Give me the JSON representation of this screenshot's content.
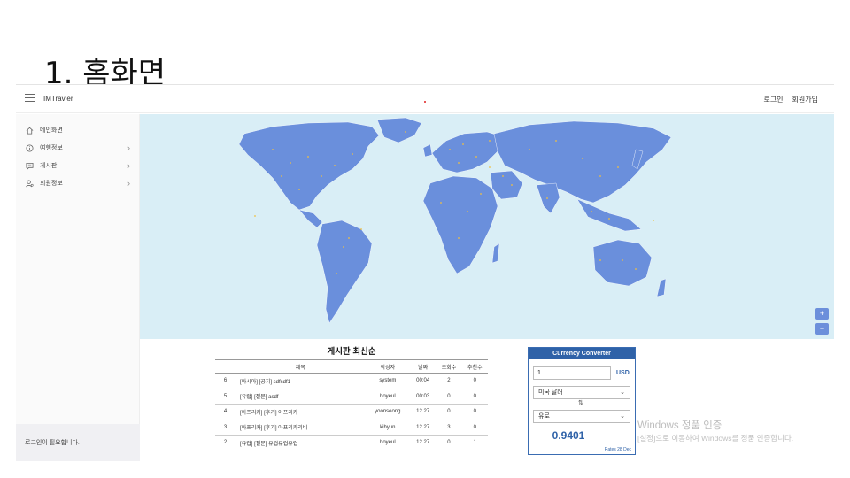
{
  "slide": {
    "title": "1. 홈화면"
  },
  "header": {
    "brand": "IMTravler",
    "links": [
      "로그인",
      "회원가입"
    ]
  },
  "sidebar": {
    "items": [
      {
        "label": "메인화면",
        "icon": "home-icon",
        "has_arrow": false
      },
      {
        "label": "여행정보",
        "icon": "info-icon",
        "has_arrow": true
      },
      {
        "label": "게시판",
        "icon": "chat-icon",
        "has_arrow": true
      },
      {
        "label": "회원정보",
        "icon": "user-settings-icon",
        "has_arrow": true
      }
    ],
    "footer": "로그인이 필요합니다."
  },
  "map": {
    "zoom_in": "+",
    "zoom_out": "−",
    "land_color": "#6a8fdc",
    "sea_color": "#d9eef6"
  },
  "board": {
    "title": "게시판 최신순",
    "columns": [
      "",
      "제목",
      "작성자",
      "날짜",
      "조회수",
      "추천수"
    ],
    "rows": [
      [
        "6",
        "[아시아] [공지] sdfsdf1",
        "system",
        "00:04",
        "2",
        "0"
      ],
      [
        "5",
        "[유럽] [질문] asdf",
        "hoyeul",
        "00:03",
        "0",
        "0"
      ],
      [
        "4",
        "[아프리카] [후기] 아프리카",
        "yoonseong",
        "12.27",
        "0",
        "0"
      ],
      [
        "3",
        "[아프리카] [후기] 아프리카리비",
        "kihyun",
        "12.27",
        "3",
        "0"
      ],
      [
        "2",
        "[유럽] [질문] 유럽유럽유럽",
        "hoyeul",
        "12.27",
        "0",
        "1"
      ]
    ]
  },
  "converter": {
    "title": "Currency Converter",
    "amount": "1",
    "currency_code": "USD",
    "from": "미국 달러",
    "to": "유로",
    "result": "0.9401",
    "rates": "Rates 28 Dec",
    "accent": "#2f62a8"
  },
  "watermark": {
    "title": "Windows 정품 인증",
    "subtitle": "[설정]으로 이동하여 Windows를 정품 인증합니다."
  }
}
